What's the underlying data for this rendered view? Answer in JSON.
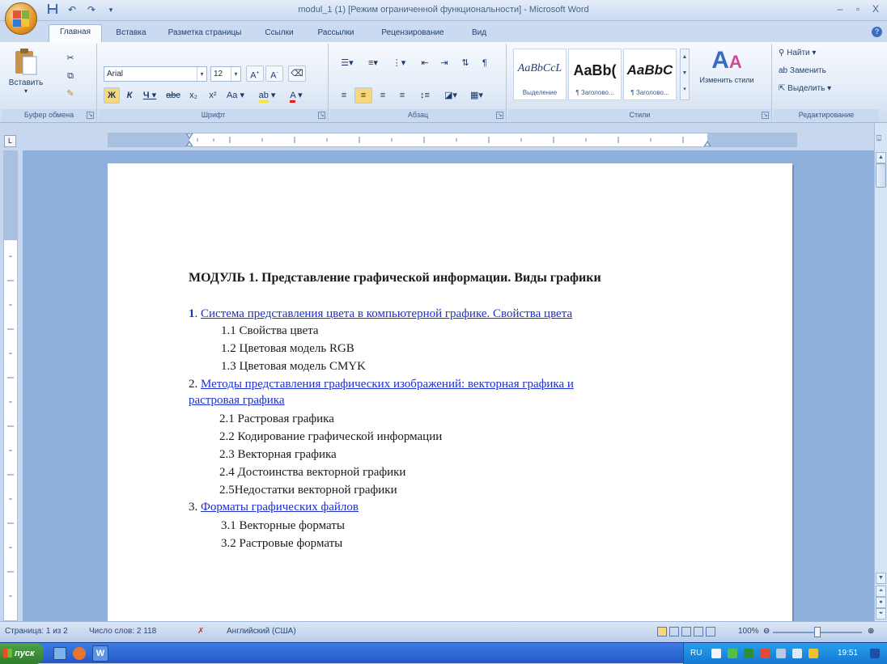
{
  "window": {
    "title": "modul_1 (1) [Режим ограниченной функциональности] - Microsoft Word",
    "controls": [
      "–",
      "▫",
      "X"
    ]
  },
  "qat": {
    "save_icon": "floppy-icon",
    "undo_icon": "undo-icon",
    "redo_icon": "redo-icon"
  },
  "tabs": [
    {
      "label": "Главная",
      "active": true
    },
    {
      "label": "Вставка"
    },
    {
      "label": "Разметка страницы"
    },
    {
      "label": "Ссылки"
    },
    {
      "label": "Рассылки"
    },
    {
      "label": "Рецензирование"
    },
    {
      "label": "Вид"
    }
  ],
  "ribbon": {
    "clipboard": {
      "label": "Буфер обмена",
      "paste": "Вставить"
    },
    "font": {
      "label": "Шрифт",
      "name": "Arial",
      "size": "12"
    },
    "paragraph": {
      "label": "Абзац"
    },
    "styles": {
      "label": "Стили",
      "tiles": [
        {
          "sample": "AaBbCcL",
          "name": "Выделение"
        },
        {
          "sample": "AaBb(",
          "name": "¶ Заголово..."
        },
        {
          "sample": "AaBbC",
          "name": "¶ Заголово..."
        }
      ],
      "change": "Изменить стили"
    },
    "editing": {
      "label": "Редактирование",
      "find": "Найти",
      "replace": "Заменить",
      "select": "Выделить"
    }
  },
  "document": {
    "title": "МОДУЛЬ 1. Представление графической информации. Виды графики",
    "sections": [
      {
        "num": "1",
        "text": "Система представления цвета в компьютерной графике. Свойства цвета",
        "items": [
          "1.1 Свойства цвета",
          "1.2 Цветовая модель RGB",
          "1.3 Цветовая модель CMYK"
        ]
      },
      {
        "num": "2.",
        "text": "Методы представления графических изображений: векторная графика и",
        "text2": "растровая графика",
        "items": [
          "2.1 Растровая графика",
          "2.2 Кодирование графической информации",
          "2.3 Векторная графика",
          "2.4 Достоинства векторной графики",
          "2.5Недостатки векторной графики"
        ]
      },
      {
        "num": "3.",
        "text": "Форматы графических файлов",
        "items": [
          "3.1 Векторные форматы",
          "3.2 Растровые форматы"
        ]
      }
    ]
  },
  "status": {
    "page": "Страница: 1 из 2",
    "words": "Число слов: 2 118",
    "language": "Английский (США)",
    "zoom": "100%",
    "zoom_level": 0.5
  },
  "taskbar": {
    "start": "пуск",
    "lang": "RU",
    "clock": "19:51"
  }
}
